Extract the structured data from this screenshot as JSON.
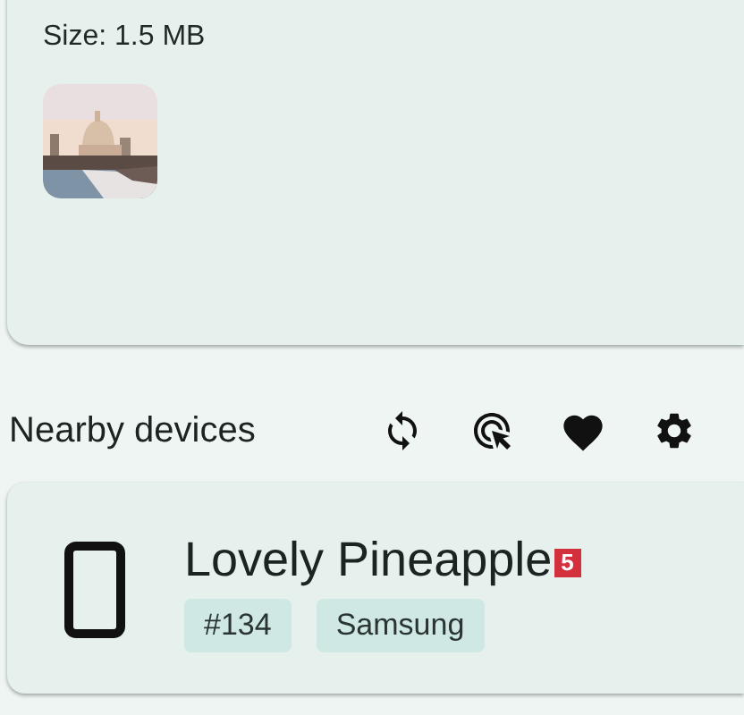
{
  "file_card": {
    "size_label": "Size: 1.5 MB"
  },
  "nearby": {
    "title": "Nearby devices"
  },
  "devices": [
    {
      "name": "Lovely Pineapple",
      "badge": "5",
      "tags": [
        "#134",
        "Samsung"
      ]
    }
  ]
}
